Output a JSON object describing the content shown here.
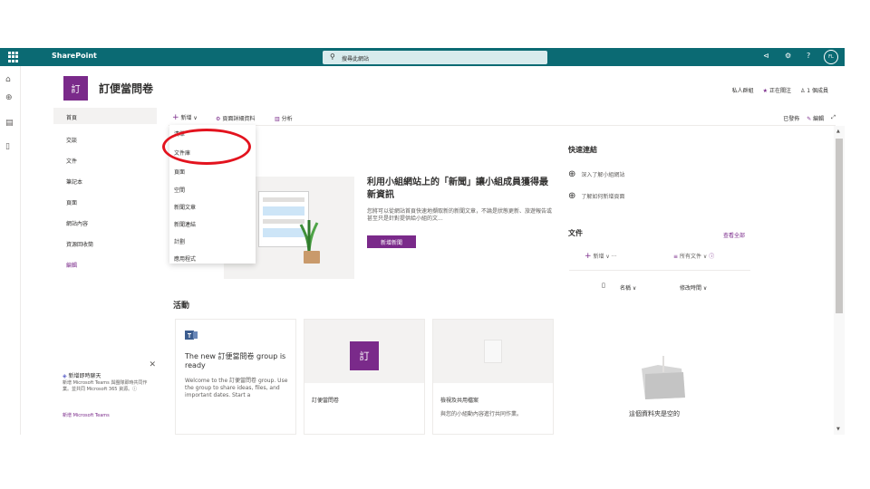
{
  "suitebar": {
    "app_name": "SharePoint",
    "search_placeholder": "搜尋此網站",
    "avatar_initials": "FL"
  },
  "site": {
    "logo_text": "訂",
    "title": "訂便當問卷",
    "private_group": "私人群組",
    "following": "正在關注",
    "members": "1 個成員"
  },
  "nav": {
    "items": [
      "首頁",
      "交談",
      "文件",
      "筆記本",
      "頁面",
      "網站內容",
      "資源回收筒",
      "編輯"
    ]
  },
  "promo": {
    "title": "新增即時聊天",
    "body": "新增 Microsoft Teams 與團隊即時共同作業。並共同 Microsoft 365 資源。ⓘ",
    "link": "新增 Microsoft Teams"
  },
  "commandbar": {
    "new": "新增",
    "page_details": "頁面詳細資料",
    "analytics": "分析",
    "published": "已發佈",
    "edit": "編輯"
  },
  "new_menu": {
    "items": [
      "清單",
      "文件庫",
      "頁面",
      "空間",
      "新聞文章",
      "新聞連結",
      "計劃",
      "應用程式"
    ]
  },
  "news": {
    "headline": "利用小組網站上的「新聞」讓小組成員獲得最新資訊",
    "description": "您將可以從網站首頁快速地擷取新的新聞文章，不論是狀態更新、旅遊報告或甚至只是針對提供給小組的文...",
    "button": "新增新聞"
  },
  "quicklinks": {
    "title": "快速連結",
    "links": [
      "深入了解小組網站",
      "了解如何新增頁面"
    ]
  },
  "documents": {
    "title": "文件",
    "see_all": "查看全部",
    "new": "新增",
    "all_docs": "所有文件",
    "col_name": "名稱",
    "col_modified": "修改時間",
    "empty": "這個資料夾是空的"
  },
  "activity": {
    "title": "活動",
    "card1_title": "The new 訂便當問卷 group is ready",
    "card1_body": "Welcome to the 訂便當問卷 group. Use the group to share ideas, files, and important dates. Start a",
    "card2_logo": "訂",
    "card2_name": "訂便當問卷",
    "card3_name": "檢視及共用檔案",
    "card3_desc": "與您的小組動內容進行共同作業。"
  },
  "colors": {
    "suitebar": "#0b6a73",
    "accent": "#7a2a8a",
    "annotation": "#e3131e"
  }
}
